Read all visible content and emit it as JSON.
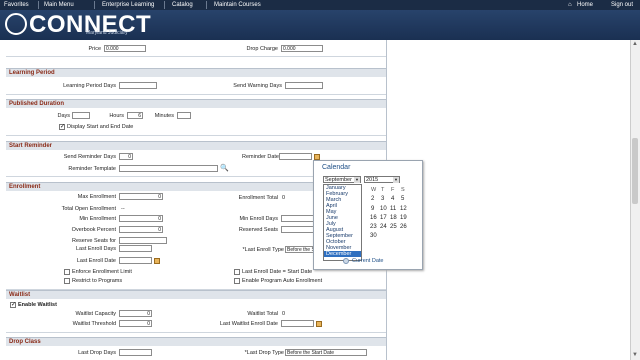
{
  "topnav": {
    "items": [
      "Favorites",
      "Main Menu",
      "Enterprise Learning",
      "Catalog",
      "Maintain Courses"
    ],
    "home": "Home",
    "signout": "Sign out"
  },
  "brand": {
    "name": "CONNECT",
    "subtitle": "Maryland Judiciary"
  },
  "pricing": {
    "price_label": "Price",
    "price_value": "0.000",
    "drop_label": "Drop Charge",
    "drop_value": "0.000"
  },
  "learning_period": {
    "title": "Learning Period",
    "days_label": "Learning Period Days",
    "warn_label": "Send Warning Days"
  },
  "duration": {
    "title": "Published Duration",
    "days_label": "Days",
    "hours_label": "Hours",
    "hours_value": "6",
    "minutes_label": "Minutes",
    "display_label": "Display Start and End Date"
  },
  "reminder": {
    "title": "Start Reminder",
    "days_label": "Send Reminder Days",
    "days_value": "0",
    "template_label": "Reminder Template",
    "date_label": "Reminder Date"
  },
  "enrollment": {
    "title": "Enrollment",
    "max_label": "Max Enrollment",
    "max_value": "0",
    "total_label": "Enrollment Total",
    "total_value": "0",
    "open_label": "Total Open Enrollment",
    "open_value": "--",
    "min_label": "Min Enrollment",
    "min_value": "0",
    "min_days_label": "Min Enroll Days",
    "overbook_label": "Overbook Percent",
    "overbook_value": "0",
    "reserved_label": "Reserved Seats",
    "reserve_for_label": "Reserve Seats for",
    "last_days_label": "Last Enroll Days",
    "last_type_label": "*Last Enroll Type",
    "last_type_value": "Before the Start Date",
    "last_date_label": "Last Enroll Date",
    "enforce_label": "Enforce Enrollment Limit",
    "restrict_label": "Restrict to Programs",
    "last_eq_label": "Last Enroll Date = Start Date",
    "auto_label": "Enable Program Auto Enrollment"
  },
  "waitlist": {
    "title": "Waitlist",
    "enable_label": "Enable Waitlist",
    "capacity_label": "Waitlist Capacity",
    "capacity_value": "0",
    "total_label": "Waitlist Total",
    "total_value": "0",
    "threshold_label": "Waitlist Threshold",
    "threshold_value": "0",
    "last_date_label": "Last Waitlist Enroll Date"
  },
  "drop": {
    "title": "Drop Class",
    "days_label": "Last Drop Days",
    "type_label": "*Last Drop Type",
    "type_value": "Before the Start Date"
  },
  "calendar": {
    "title": "Calendar",
    "month": "September",
    "year": "2015",
    "months": [
      "January",
      "February",
      "March",
      "April",
      "May",
      "June",
      "July",
      "August",
      "September",
      "October",
      "November",
      "December"
    ],
    "highlighted": "December",
    "dow": [
      "W",
      "T",
      "F",
      "S"
    ],
    "days": [
      "2",
      "3",
      "4",
      "5",
      "9",
      "10",
      "11",
      "12",
      "16",
      "17",
      "18",
      "19",
      "23",
      "24",
      "25",
      "26",
      "30"
    ],
    "current_date": "Current Date"
  }
}
